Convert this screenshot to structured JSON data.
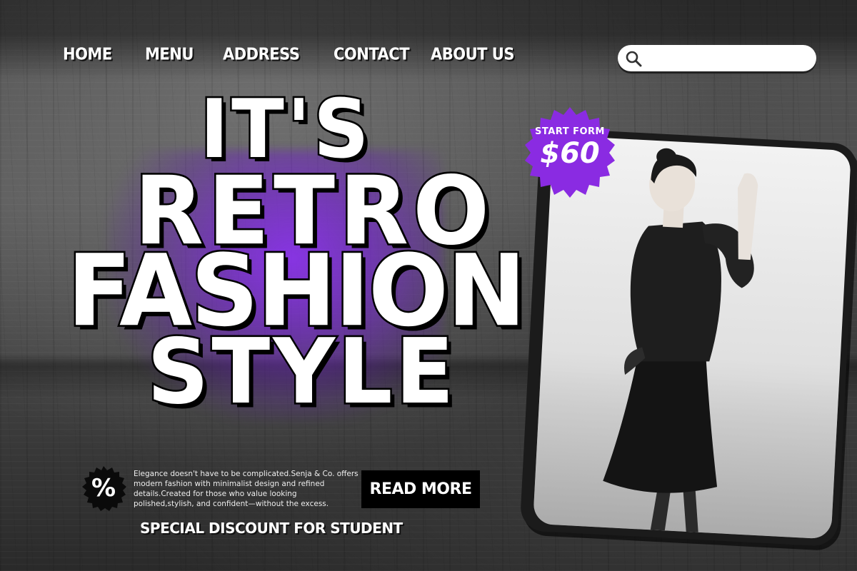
{
  "nav": {
    "items": [
      "HOME",
      "MENU",
      "ADDRESS",
      "CONTACT",
      "ABOUT US"
    ]
  },
  "search": {
    "placeholder": "",
    "value": ""
  },
  "hero": {
    "line1": "IT'S",
    "line2": "RETRO",
    "line3": "FASHION",
    "line4": "STYLE"
  },
  "price_badge": {
    "label": "START FORM",
    "price": "$60",
    "color": "#8a2be2"
  },
  "promo": {
    "icon_symbol": "%",
    "description": "Elegance doesn't have to be complicated.Senja & Co. offers modern fashion with minimalist design and refined details.Created for those who value looking polished,stylish, and confident—without the excess.",
    "cta_label": "READ MORE",
    "discount_text": "SPECIAL DISCOUNT FOR STUDENT"
  },
  "colors": {
    "accent": "#8a2be2",
    "text": "#ffffff",
    "background": "#4a4a4a"
  }
}
